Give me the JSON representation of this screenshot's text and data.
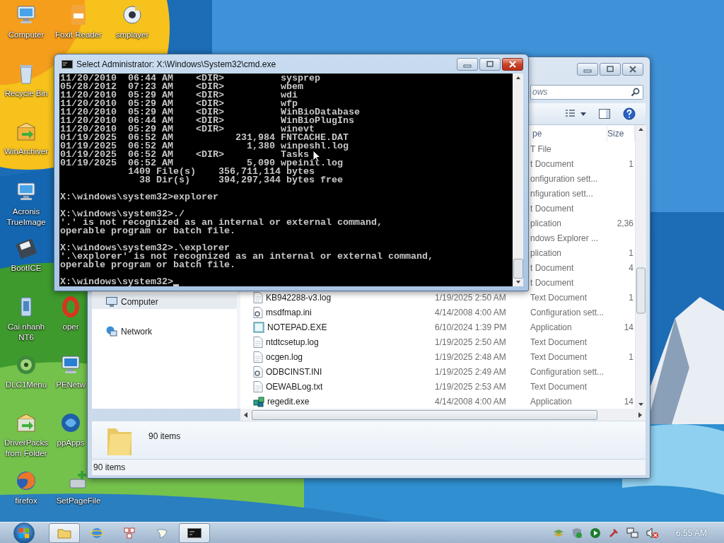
{
  "desktop_icons": [
    {
      "label": "Computer",
      "kind": "computer"
    },
    {
      "label": "Foxit Reader",
      "kind": "pdf"
    },
    {
      "label": "smplayer",
      "kind": "player"
    },
    {
      "label": "Recycle Bin",
      "kind": "bin"
    },
    {
      "label": "WinArchiver",
      "kind": "archive"
    },
    {
      "label": "Acronis TrueImage",
      "kind": "monitor"
    },
    {
      "label": "BootICE",
      "kind": "disk"
    },
    {
      "label": "Cai nhanh NT6",
      "kind": "installer"
    },
    {
      "label": "oper",
      "kind": "ring"
    },
    {
      "label": "DLC1Menu",
      "kind": "disc"
    },
    {
      "label": "PENetw",
      "kind": "network"
    },
    {
      "label": "DriverPacks from Folder",
      "kind": "packs"
    },
    {
      "label": "ppApps",
      "kind": "globe"
    },
    {
      "label": "firefox",
      "kind": "browser"
    },
    {
      "label": "SetPageFile",
      "kind": "tool"
    }
  ],
  "explorer": {
    "active": false,
    "search": {
      "placeholder": "ows"
    },
    "sidebar": {
      "items": [
        {
          "label": "Computer",
          "selected": true
        },
        {
          "label": "Network",
          "selected": false
        }
      ]
    },
    "columns": [
      "pe",
      "Size"
    ],
    "rows": [
      {
        "type": "T File"
      },
      {
        "type": "t Document",
        "size": "1"
      },
      {
        "type": "onfiguration sett..."
      },
      {
        "type": "nfiguration sett..."
      },
      {
        "type": "t Document"
      },
      {
        "type": "plication",
        "size": "2,36"
      },
      {
        "type": "ndows Explorer ..."
      },
      {
        "type": "plication",
        "size": "1"
      },
      {
        "type": "t Document",
        "size": "4"
      },
      {
        "type": "t Document"
      },
      {
        "name": "KB942288-v3.log",
        "kind": "text",
        "date": "1/19/2025 2:50 AM",
        "type": "Text Document",
        "size": "1"
      },
      {
        "name": "msdfmap.ini",
        "kind": "config",
        "date": "4/14/2008 4:00 AM",
        "type": "Configuration sett..."
      },
      {
        "name": "NOTEPAD.EXE",
        "kind": "app",
        "date": "6/10/2024 1:39 PM",
        "type": "Application",
        "size": "14"
      },
      {
        "name": "ntdtcsetup.log",
        "kind": "text",
        "date": "1/19/2025 2:50 AM",
        "type": "Text Document"
      },
      {
        "name": "ocgen.log",
        "kind": "text",
        "date": "1/19/2025 2:48 AM",
        "type": "Text Document",
        "size": "1"
      },
      {
        "name": "ODBCINST.INI",
        "kind": "config",
        "date": "1/19/2025 2:49 AM",
        "type": "Configuration sett..."
      },
      {
        "name": "OEWABLog.txt",
        "kind": "text",
        "date": "1/19/2025 2:53 AM",
        "type": "Text Document"
      },
      {
        "name": "regedit.exe",
        "kind": "registry",
        "date": "4/14/2008 4:00 AM",
        "type": "Application",
        "size": "14"
      }
    ],
    "details": "90 items",
    "status_bar": "90 items"
  },
  "cmd": {
    "title": "Select Administrator: X:\\Windows\\System32\\cmd.exe",
    "active": true,
    "cursor": true,
    "blocks": [
      [
        "11/20/2010  06:44 AM    <DIR>          sysprep",
        "05/28/2012  07:23 AM    <DIR>          wbem",
        "11/20/2010  05:29 AM    <DIR>          wdi",
        "11/20/2010  05:29 AM    <DIR>          wfp",
        "11/20/2010  05:29 AM    <DIR>          WinBioDatabase",
        "11/20/2010  06:44 AM    <DIR>          WinBioPlugIns",
        "11/20/2010  05:29 AM    <DIR>          winevt",
        "01/19/2025  06:52 AM           231,984 FNTCACHE.DAT",
        "01/19/2025  06:52 AM             1,380 winpeshl.log",
        "01/19/2025  06:52 AM    <DIR>          Tasks",
        "01/19/2025  06:52 AM             5,090 wpeinit.log",
        "            1409 File(s)    356,711,114 bytes",
        "              38 Dir(s)     394,297,344 bytes free"
      ],
      [
        "X:\\windows\\system32>explorer"
      ],
      [
        "X:\\windows\\system32>./",
        "'.' is not recognized as an internal or external command,",
        "operable program or batch file."
      ],
      [
        "X:\\windows\\system32>.\\explorer",
        "'.\\explorer' is not recognized as an internal or external command,",
        "operable program or batch file."
      ],
      [
        "X:\\windows\\system32>"
      ]
    ]
  },
  "taskbar": {
    "buttons": [
      {
        "kind": "folder",
        "running": true
      },
      {
        "kind": "browser",
        "running": false
      },
      {
        "kind": "grid",
        "running": false
      },
      {
        "kind": "bird",
        "running": false
      },
      {
        "kind": "console",
        "running": true
      }
    ],
    "clock": "6:55 AM"
  }
}
